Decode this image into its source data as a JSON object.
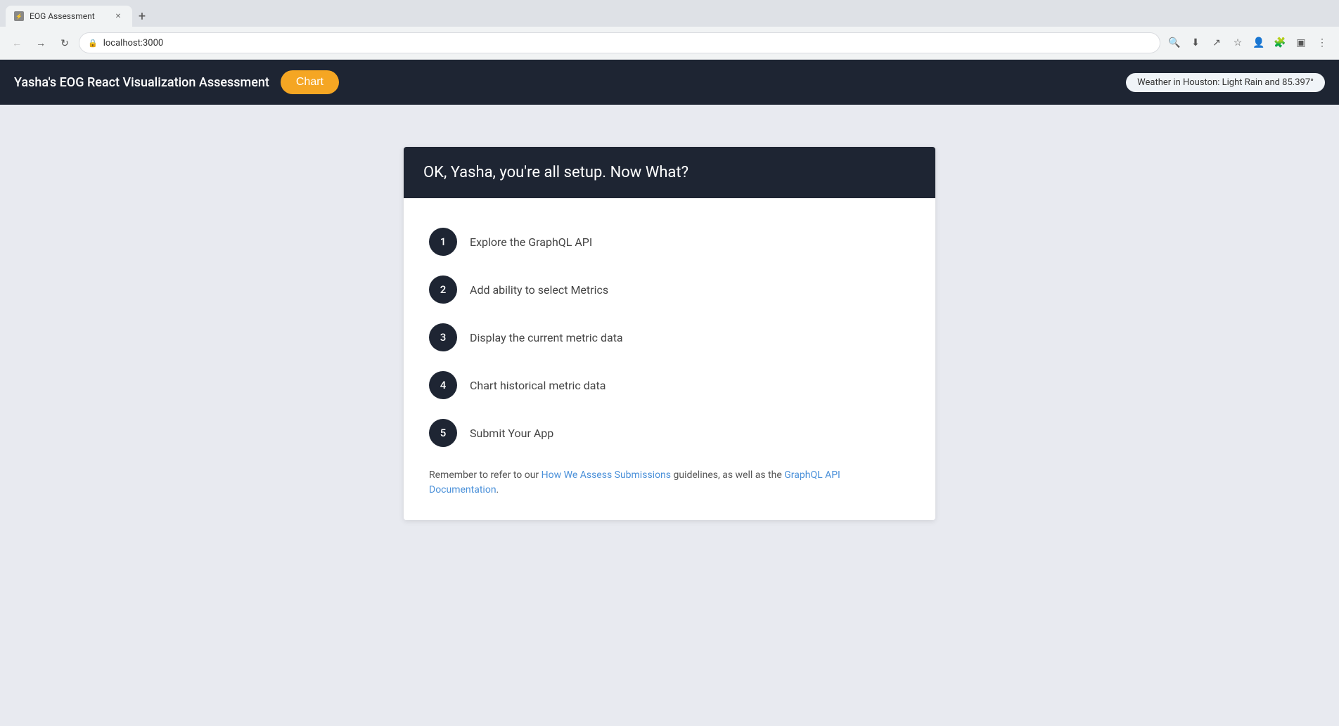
{
  "browser": {
    "tab_title": "EOG Assessment",
    "url": "localhost:3000",
    "new_tab_label": "+"
  },
  "header": {
    "app_title": "Yasha's EOG React Visualization Assessment",
    "chart_button_label": "Chart",
    "weather_text": "Weather in Houston: Light Rain and 85.397°"
  },
  "card": {
    "heading": "OK, Yasha, you're all setup. Now What?",
    "steps": [
      {
        "number": "1",
        "text": "Explore the GraphQL API"
      },
      {
        "number": "2",
        "text": "Add ability to select Metrics"
      },
      {
        "number": "3",
        "text": "Display the current metric data"
      },
      {
        "number": "4",
        "text": "Chart historical metric data"
      },
      {
        "number": "5",
        "text": "Submit Your App"
      }
    ],
    "footer_prefix": "Remember to refer to our ",
    "footer_link1_text": "How We Assess Submissions",
    "footer_link1_href": "#",
    "footer_middle": " guidelines, as well as the ",
    "footer_link2_text": "GraphQL API Documentation",
    "footer_link2_href": "#",
    "footer_suffix": "."
  },
  "icons": {
    "back": "←",
    "forward": "→",
    "reload": "↻",
    "lock": "🔒",
    "star": "☆",
    "account": "👤",
    "extensions": "🧩",
    "menu": "⋮",
    "close": "✕",
    "sidebar": "▣"
  }
}
